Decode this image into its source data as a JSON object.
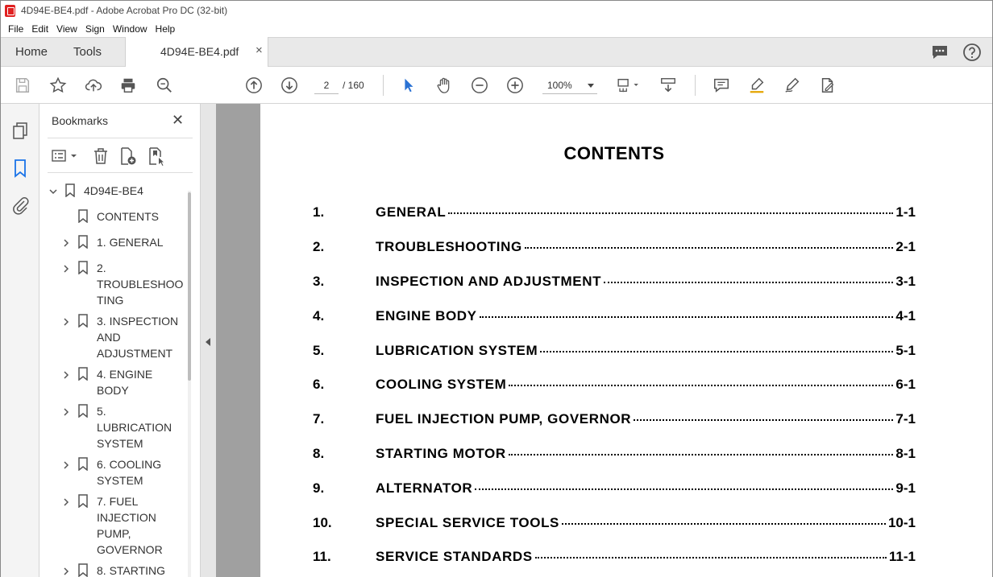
{
  "window": {
    "title": "4D94E-BE4.pdf - Adobe Acrobat Pro DC (32-bit)"
  },
  "menu": [
    "File",
    "Edit",
    "View",
    "Sign",
    "Window",
    "Help"
  ],
  "tabs": {
    "home": "Home",
    "tools": "Tools",
    "doc": "4D94E-BE4.pdf",
    "close": "×"
  },
  "toolbar": {
    "page_current": "2",
    "page_total": "/  160",
    "zoom": "100%"
  },
  "bookmarks": {
    "title": "Bookmarks",
    "close": "✕",
    "items": [
      {
        "text": "4D94E-BE4",
        "expanded": true
      },
      {
        "text": "CONTENTS"
      },
      {
        "text": "1. GENERAL"
      },
      {
        "text": "2.\nTROUBLESHOO\nTING"
      },
      {
        "text": "3. INSPECTION\nAND\nADJUSTMENT"
      },
      {
        "text": "4. ENGINE\nBODY"
      },
      {
        "text": "5.\nLUBRICATION\nSYSTEM"
      },
      {
        "text": "6. COOLING\nSYSTEM"
      },
      {
        "text": "7. FUEL\nINJECTION\nPUMP,\nGOVERNOR"
      },
      {
        "text": "8. STARTING"
      }
    ]
  },
  "document": {
    "title": "CONTENTS",
    "toc": [
      {
        "num": "1.",
        "title": "GENERAL",
        "page": "1-1"
      },
      {
        "num": "2.",
        "title": "TROUBLESHOOTING",
        "page": "2-1"
      },
      {
        "num": "3.",
        "title": "INSPECTION AND ADJUSTMENT",
        "page": "3-1"
      },
      {
        "num": "4.",
        "title": "ENGINE BODY",
        "page": "4-1"
      },
      {
        "num": "5.",
        "title": "LUBRICATION SYSTEM",
        "page": "5-1"
      },
      {
        "num": "6.",
        "title": "COOLING SYSTEM",
        "page": "6-1"
      },
      {
        "num": "7.",
        "title": "FUEL INJECTION PUMP, GOVERNOR",
        "page": "7-1"
      },
      {
        "num": "8.",
        "title": "STARTING MOTOR",
        "page": "8-1"
      },
      {
        "num": "9.",
        "title": "ALTERNATOR",
        "page": "9-1"
      },
      {
        "num": "10.",
        "title": "SPECIAL SERVICE TOOLS",
        "page": "10-1"
      },
      {
        "num": "11.",
        "title": "SERVICE STANDARDS",
        "page": "11-1"
      }
    ]
  }
}
